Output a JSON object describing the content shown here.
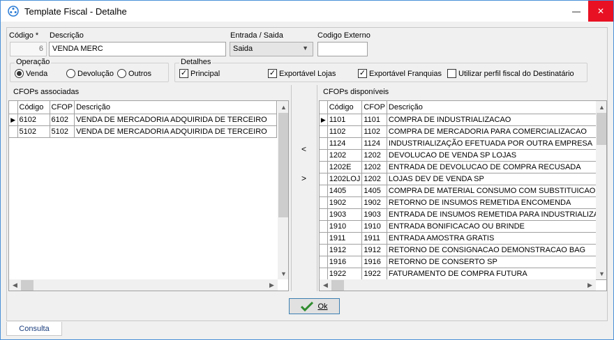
{
  "window": {
    "title": "Template Fiscal - Detalhe",
    "minimize": "—",
    "close": "✕"
  },
  "form": {
    "codigo_label": "Código *",
    "codigo_value": "6",
    "descricao_label": "Descrição",
    "descricao_value": "VENDA MERC",
    "entrada_saida_label": "Entrada / Saida",
    "entrada_saida_value": "Saida",
    "codigo_externo_label": "Codigo Externo",
    "codigo_externo_value": ""
  },
  "operacao": {
    "legend": "Operação",
    "options": [
      {
        "label": "Venda",
        "selected": true
      },
      {
        "label": "Devolução",
        "selected": false
      },
      {
        "label": "Outros",
        "selected": false
      }
    ]
  },
  "detalhes": {
    "legend": "Detalhes",
    "options": [
      {
        "label": "Principal",
        "checked": true
      },
      {
        "label": "Exportável Lojas",
        "checked": true
      },
      {
        "label": "Exportável Franquias",
        "checked": true
      },
      {
        "label": "Utilizar perfil fiscal do Destinatário",
        "checked": false
      }
    ]
  },
  "left_grid": {
    "title": "CFOPs associadas",
    "columns": [
      "Código",
      "CFOP",
      "Descrição"
    ],
    "rows": [
      [
        "6102",
        "6102",
        "VENDA DE MERCADORIA ADQUIRIDA DE TERCEIRO"
      ],
      [
        "5102",
        "5102",
        "VENDA DE MERCADORIA ADQUIRIDA DE TERCEIRO"
      ]
    ]
  },
  "move_buttons": {
    "left": "<",
    "right": ">"
  },
  "right_grid": {
    "title": "CFOPs disponíveis",
    "columns": [
      "Código",
      "CFOP",
      "Descrição"
    ],
    "rows": [
      [
        "1101",
        "1101",
        "COMPRA DE INDUSTRIALIZACAO"
      ],
      [
        "1102",
        "1102",
        "COMPRA DE MERCADORIA  PARA COMERCIALIZACAO"
      ],
      [
        "1124",
        "1124",
        "INDUSTRIALIZAÇÃO EFETUADA POR OUTRA EMPRESA"
      ],
      [
        "1202",
        "1202",
        "DEVOLUCAO DE VENDA SP LOJAS"
      ],
      [
        "1202E",
        "1202",
        "ENTRADA DE DEVOLUCAO DE COMPRA RECUSADA"
      ],
      [
        "1202LOJ",
        "1202",
        "LOJAS DEV DE VENDA SP"
      ],
      [
        "1405",
        "1405",
        "COMPRA DE MATERIAL CONSUMO COM SUBSTITUICAO"
      ],
      [
        "1902",
        "1902",
        "RETORNO DE INSUMOS REMETIDA ENCOMENDA"
      ],
      [
        "1903",
        "1903",
        "ENTRADA DE INSUMOS REMETIDA PARA INDUSTRIALIZAÇ"
      ],
      [
        "1910",
        "1910",
        "ENTRADA BONIFICACAO OU BRINDE"
      ],
      [
        "1911",
        "1911",
        "ENTRADA AMOSTRA GRATIS"
      ],
      [
        "1912",
        "1912",
        "RETORNO DE CONSIGNACAO DEMONSTRACAO BAG"
      ],
      [
        "1916",
        "1916",
        "RETORNO DE CONSERTO SP"
      ],
      [
        "1922",
        "1922",
        "FATURAMENTO DE COMPRA FUTURA"
      ]
    ]
  },
  "ok_button": {
    "label": "Ok"
  },
  "tabs": [
    {
      "label": "Consulta"
    }
  ],
  "colors": {
    "accent": "#4a90d9",
    "close": "#e81123",
    "check": "#2e8b2e"
  }
}
